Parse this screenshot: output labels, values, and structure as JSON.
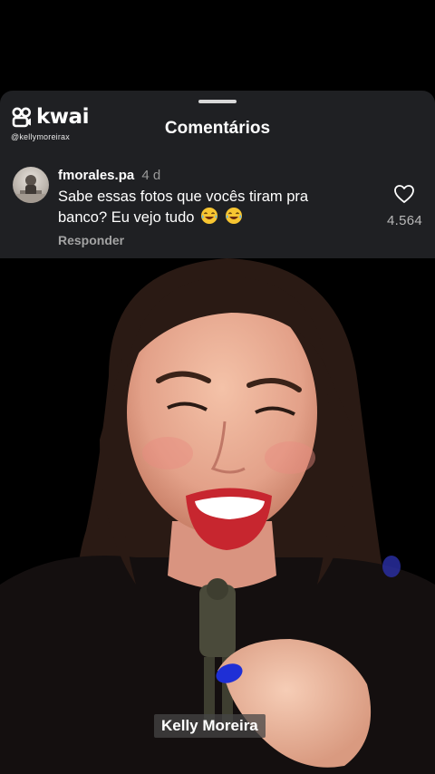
{
  "brand": {
    "name": "kwai",
    "handle": "@kellymoreirax"
  },
  "sheet": {
    "title": "Comentários"
  },
  "comment": {
    "username": "fmorales.pa",
    "age": "4 d",
    "text": "Sabe essas fotos que vocês tiram pra banco? Eu vejo tudo",
    "emoji": [
      "laughing-tears-emoji",
      "laughing-tears-emoji"
    ],
    "reply_label": "Responder",
    "likes": "4.564"
  },
  "video": {
    "caption": "Kelly Moreira"
  },
  "colors": {
    "sheet_bg": "#1f2023",
    "page_bg": "#000000",
    "muted_text": "#a3a3a3",
    "nail_polish": "#1e2fd6"
  }
}
